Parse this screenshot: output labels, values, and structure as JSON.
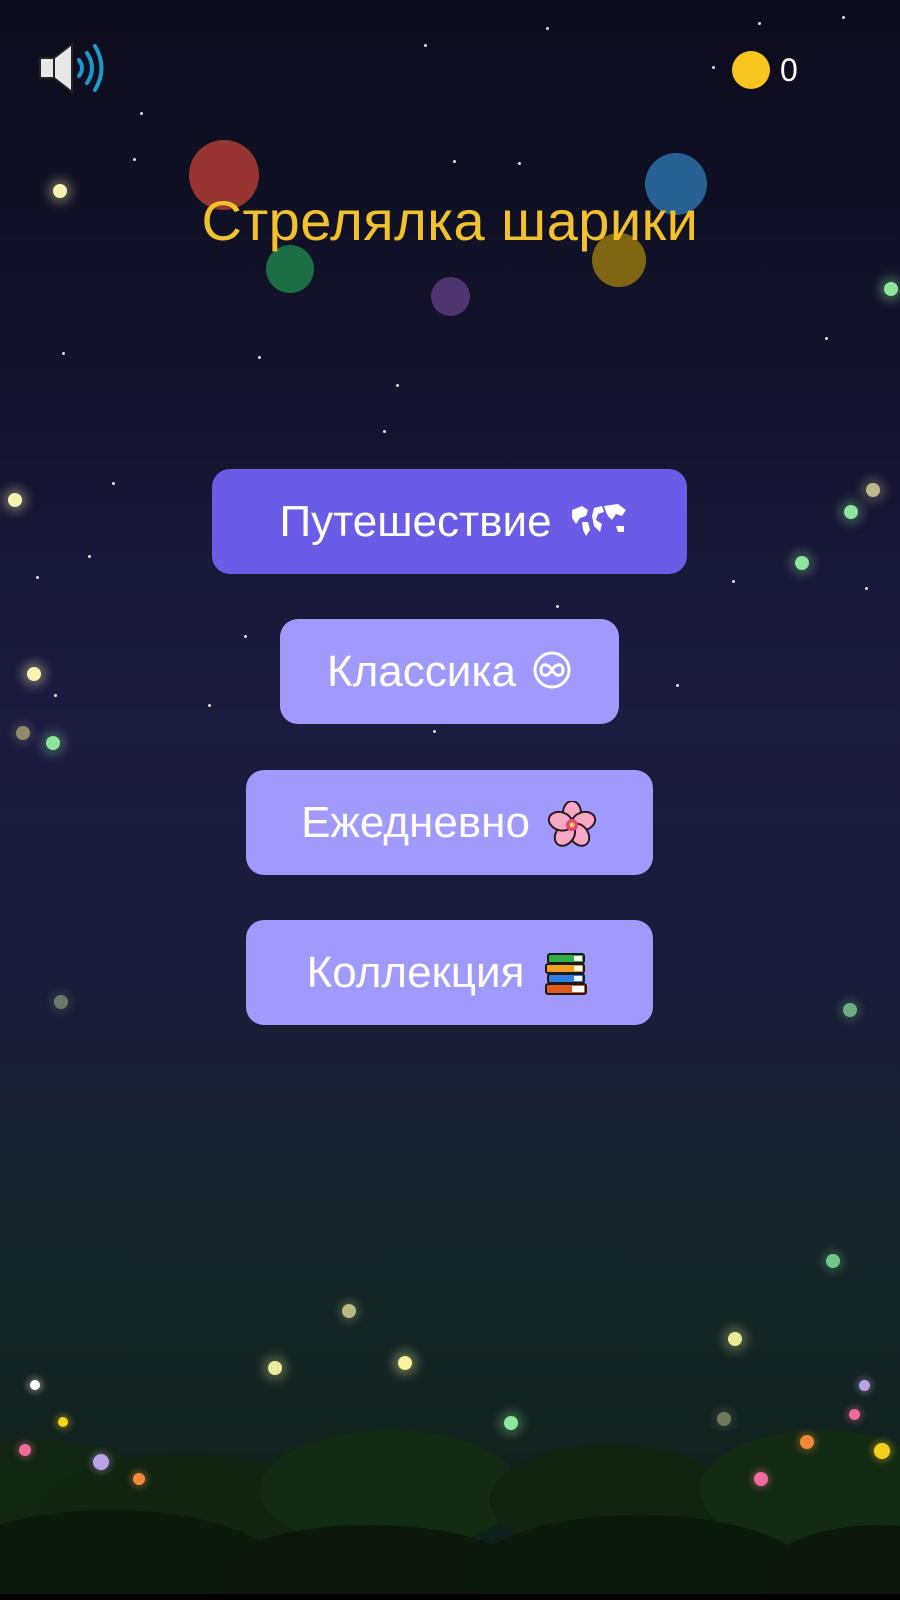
{
  "game": {
    "title": "Стрелялка шарики",
    "coins": "0"
  },
  "icons": {
    "sound": "speaker-on-icon",
    "coin": "coin-icon",
    "journey": "world-map-icon",
    "classic": "infinity-icon",
    "daily": "cherry-blossom-icon",
    "collection": "books-icon"
  },
  "menu": {
    "journey_label": "Путешествие",
    "classic_label": "Классика",
    "daily_label": "Ежедневно",
    "collection_label": "Коллекция"
  },
  "colors": {
    "title": "#f2c12e",
    "coin": "#f7c51e",
    "primary_button": "#6a5ce6",
    "secondary_button": "#a09afc",
    "bubble_red": "#b03a36",
    "bubble_blue": "#2a6fa8",
    "bubble_green": "#1f7a4a",
    "bubble_yellow": "#9a7a12",
    "bubble_purple": "#5a3a7a"
  }
}
